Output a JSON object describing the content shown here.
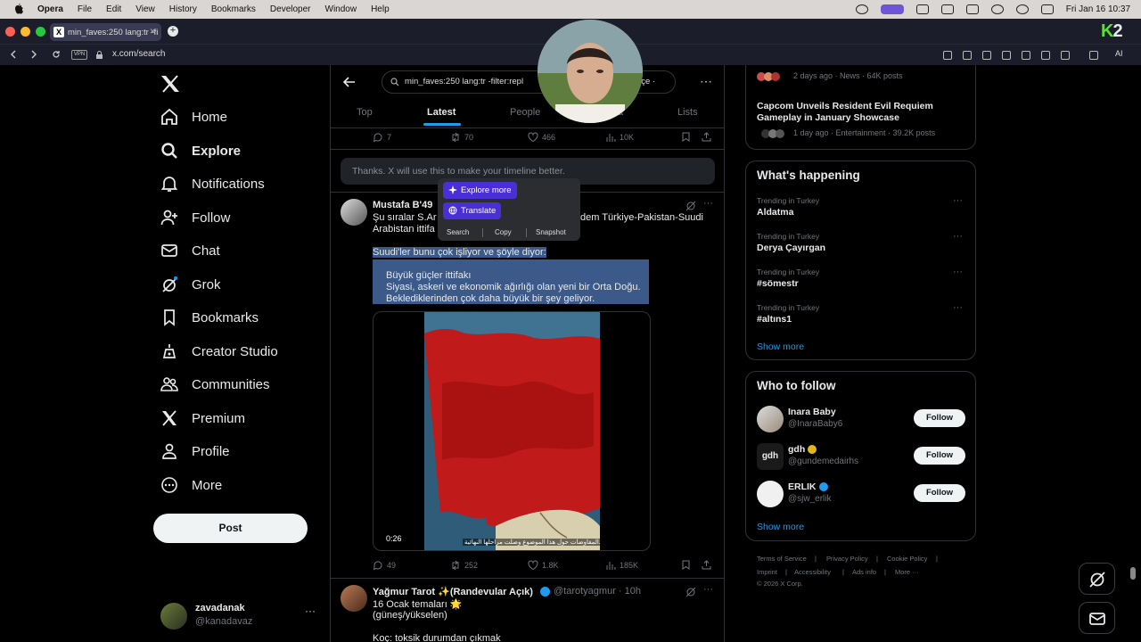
{
  "menubar": {
    "app": "Opera",
    "items": [
      "File",
      "Edit",
      "View",
      "History",
      "Bookmarks",
      "Developer",
      "Window",
      "Help"
    ],
    "clock": "Fri Jan 16  10:37"
  },
  "browser": {
    "tab_title": "min_faves:250 lang:tr -fi",
    "vpn_label": "VPN",
    "url": "x.com/search",
    "ai_label": "AI",
    "badge": "K2"
  },
  "sidebar": {
    "items": [
      {
        "label": "Home",
        "icon": "home-icon"
      },
      {
        "label": "Explore",
        "icon": "search-icon"
      },
      {
        "label": "Notifications",
        "icon": "bell-icon"
      },
      {
        "label": "Follow",
        "icon": "add-person-icon"
      },
      {
        "label": "Chat",
        "icon": "mail-icon"
      },
      {
        "label": "Grok",
        "icon": "grok-icon"
      },
      {
        "label": "Bookmarks",
        "icon": "bookmark-icon"
      },
      {
        "label": "Creator Studio",
        "icon": "creator-icon"
      },
      {
        "label": "Communities",
        "icon": "communities-icon"
      },
      {
        "label": "Premium",
        "icon": "x-icon"
      },
      {
        "label": "Profile",
        "icon": "person-icon"
      },
      {
        "label": "More",
        "icon": "more-circle-icon"
      }
    ],
    "post_button": "Post",
    "account": {
      "name": "zavadanak",
      "handle": "@kanadavaz"
    }
  },
  "search": {
    "query_left": "min_faves:250 lang:tr -filter:repl",
    "query_right": "hçe ·",
    "tabs": [
      "Top",
      "Latest",
      "People",
      "a",
      "Lists"
    ],
    "active_tab": "Latest"
  },
  "feed": {
    "top_actions": {
      "replies": "7",
      "reposts": "70",
      "likes": "466",
      "views": "10K"
    },
    "feedback": "Thanks. X will use this to make your timeline better.",
    "tweet1": {
      "name": "Mustafa B'49",
      "line1_left": "Şu sıralar S.Ar",
      "line1_right": "dem Türkiye-Pakistan-Suudi",
      "line2": "Arabistan ittifa",
      "sel1": "Suudi'ler bunu çok işliyor ve şöyle diyor:",
      "sel2": "Büyük güçler ittifakı",
      "sel3": "Siyasi, askeri ve ekonomik ağırlığı olan yeni bir Orta Doğu.",
      "sel4": "Beklediklerinden çok daha büyük bir şey geliyor.",
      "video_time": "0:26",
      "video_sub": "المفاوضات حول هذا الموضوع وصلت مراحلها النهائية.",
      "actions": {
        "replies": "49",
        "reposts": "252",
        "likes": "1.8K",
        "views": "185K"
      }
    },
    "tweet2": {
      "name": "Yağmur Tarot ✨(Randevular Açık)",
      "handle": "@tarotyagmur · 10h",
      "line1": "16 Ocak temaları 🌟",
      "line2": "(güneş/yükselen)",
      "line3": "Koç: toksik durumdan çıkmak"
    }
  },
  "popup": {
    "explore": "Explore more",
    "translate": "Translate",
    "search": "Search",
    "copy": "Copy",
    "snapshot": "Snapshot"
  },
  "right": {
    "top_meta1": "2 days ago · News · 64K posts",
    "top_title": "Capcom Unveils Resident Evil Requiem Gameplay in January Showcase",
    "top_meta2": "1 day ago · Entertainment · 39.2K posts",
    "happening_title": "What's happening",
    "trends": [
      {
        "context": "Trending in Turkey",
        "name": "Aldatma"
      },
      {
        "context": "Trending in Turkey",
        "name": "Derya Çayırgan"
      },
      {
        "context": "Trending in Turkey",
        "name": "#sömestr"
      },
      {
        "context": "Trending in Turkey",
        "name": "#altıns1"
      }
    ],
    "show_more": "Show more",
    "follow_title": "Who to follow",
    "follow": [
      {
        "name": "Inara Baby",
        "handle": "@InaraBaby6",
        "button": "Follow"
      },
      {
        "name": "gdh",
        "handle": "@gundemedairhs",
        "button": "Follow"
      },
      {
        "name": "ERLIK",
        "handle": "@sjw_erlik",
        "button": "Follow"
      }
    ],
    "follow_avatar_text": "gdh",
    "footer": [
      "Terms of Service",
      "Privacy Policy",
      "Cookie Policy",
      "Imprint",
      "Accessibility",
      "Ads info",
      "More ···",
      "© 2026 X Corp."
    ],
    "footer_sep": "|"
  },
  "colors": {
    "accent": "#1d9bf0",
    "popup": "#4b2fd6",
    "menubar": "#d9d6d3",
    "browser": "#1c1d2b"
  }
}
